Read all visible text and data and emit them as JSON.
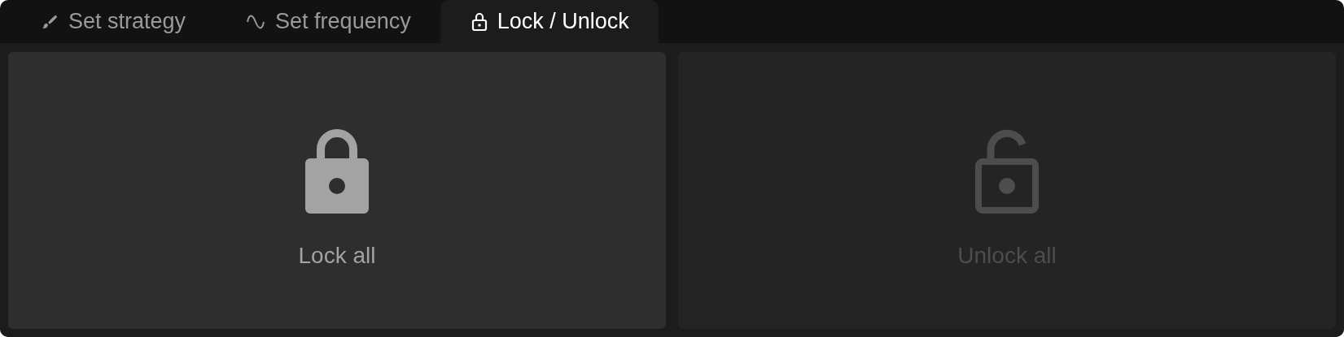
{
  "tabs": [
    {
      "label": "Set strategy",
      "kind": "brush",
      "selected": false
    },
    {
      "label": "Set frequency",
      "kind": "wave",
      "selected": false
    },
    {
      "label": "Lock / Unlock",
      "kind": "lock",
      "selected": true
    }
  ],
  "actions": [
    {
      "label": "Lock all",
      "kind": "lock",
      "disabled": false
    },
    {
      "label": "Unlock all",
      "kind": "unlock",
      "disabled": true
    }
  ]
}
